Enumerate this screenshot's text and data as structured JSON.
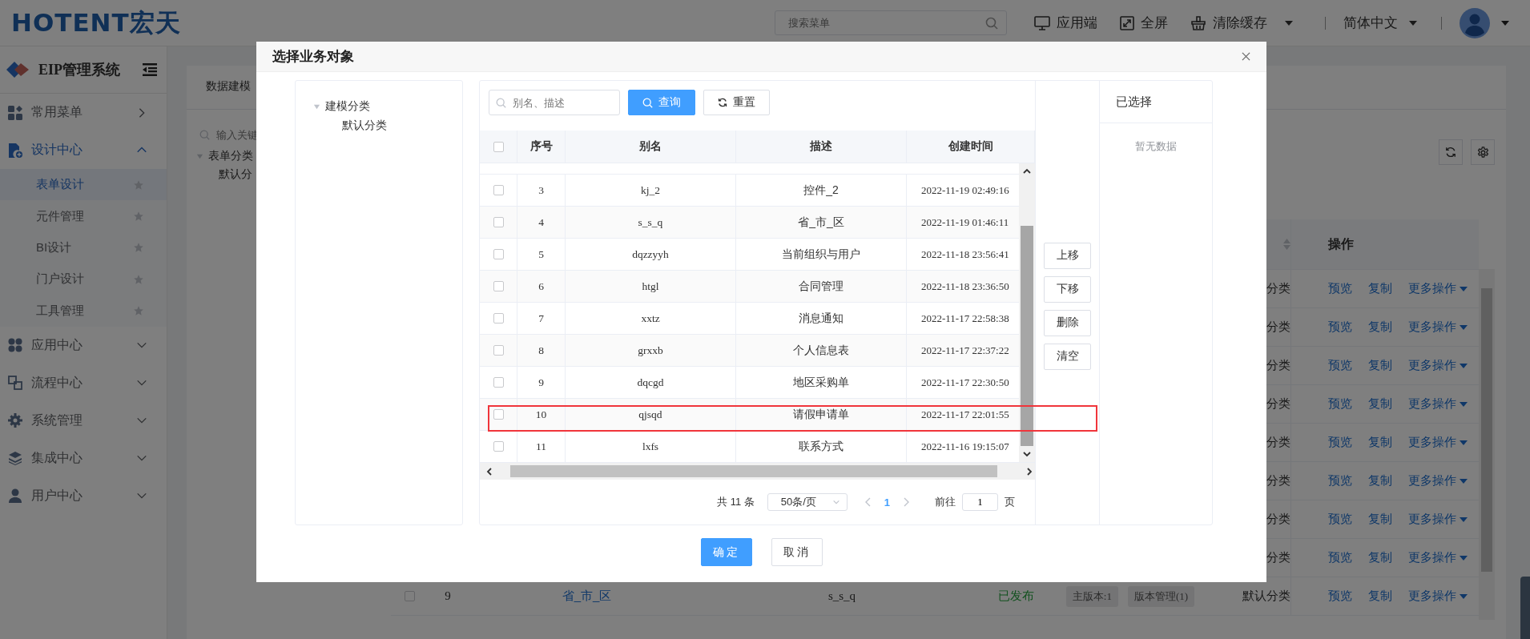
{
  "header": {
    "logo": "HOTENT宏天",
    "search": {
      "placeholder": "搜索菜单"
    },
    "tools": [
      {
        "label": "应用端",
        "dropdown": false
      },
      {
        "label": "全屏",
        "dropdown": false
      },
      {
        "label": "清除缓存",
        "dropdown": true
      }
    ],
    "language": "简体中文"
  },
  "sidebar": {
    "title": "EIP管理系统",
    "items": [
      {
        "kind": "flyout",
        "label": "常用菜单",
        "expanded": false
      },
      {
        "kind": "group",
        "label": "设计中心",
        "expanded": true,
        "children": [
          {
            "label": "表单设计",
            "selected": true
          },
          {
            "label": "元件管理",
            "selected": false
          },
          {
            "label": "BI设计",
            "selected": false
          },
          {
            "label": "门户设计",
            "selected": false
          },
          {
            "label": "工具管理",
            "selected": false
          }
        ]
      },
      {
        "kind": "group",
        "label": "应用中心",
        "expanded": false
      },
      {
        "kind": "group",
        "label": "流程中心",
        "expanded": false
      },
      {
        "kind": "group",
        "label": "系统管理",
        "expanded": false
      },
      {
        "kind": "group",
        "label": "集成中心",
        "expanded": false
      },
      {
        "kind": "group",
        "label": "用户中心",
        "expanded": false
      }
    ]
  },
  "background": {
    "tab": "数据建模",
    "tree_search": {
      "placeholder": "输入关键"
    },
    "tree": {
      "label": "表单分类",
      "expanded": true,
      "children": [
        {
          "label": "默认分"
        }
      ]
    },
    "table": {
      "actions_header": "操作",
      "rows": [
        {
          "category": "分类",
          "actions": [
            "预览",
            "复制",
            "更多操作"
          ]
        },
        {
          "category": "分类",
          "actions": [
            "预览",
            "复制",
            "更多操作"
          ]
        },
        {
          "category": "分类",
          "actions": [
            "预览",
            "复制",
            "更多操作"
          ]
        },
        {
          "category": "分类",
          "actions": [
            "预览",
            "复制",
            "更多操作"
          ]
        },
        {
          "category": "分类",
          "actions": [
            "预览",
            "复制",
            "更多操作"
          ]
        },
        {
          "category": "分类",
          "actions": [
            "预览",
            "复制",
            "更多操作"
          ]
        },
        {
          "category": "分类",
          "actions": [
            "预览",
            "复制",
            "更多操作"
          ]
        },
        {
          "category": "分类",
          "actions": [
            "预览",
            "复制",
            "更多操作"
          ]
        },
        {
          "checked": false,
          "number": "9",
          "alias": "省_市_区",
          "name": "s_s_q",
          "status": "已发布",
          "version": "主版本:1",
          "version_manage": "版本管理(1)",
          "category": "默认分类",
          "actions": [
            "预览",
            "复制",
            "更多操作"
          ]
        }
      ]
    }
  },
  "dialog": {
    "title": "选择业务对象",
    "tree": {
      "label": "建模分类",
      "expanded": true,
      "children": [
        {
          "label": "默认分类"
        }
      ]
    },
    "search": {
      "placeholder": "别名、描述"
    },
    "buttons": [
      {
        "label": "查询",
        "kind": "primary"
      },
      {
        "label": "重置",
        "kind": "default"
      }
    ],
    "table": {
      "select_all": {
        "checked": false
      },
      "columns": [
        "序号",
        "别名",
        "描述",
        "创建时间"
      ],
      "rows": [
        {
          "checked": false,
          "highlighted": false,
          "number": "3",
          "alias": "kj_2",
          "description": "控件_2",
          "created": "2022-11-19 02:49:16"
        },
        {
          "checked": false,
          "highlighted": false,
          "number": "4",
          "alias": "s_s_q",
          "description": "省_市_区",
          "created": "2022-11-19 01:46:11"
        },
        {
          "checked": false,
          "highlighted": false,
          "number": "5",
          "alias": "dqzzyyh",
          "description": "当前组织与用户",
          "created": "2022-11-18 23:56:41"
        },
        {
          "checked": false,
          "highlighted": false,
          "number": "6",
          "alias": "htgl",
          "description": "合同管理",
          "created": "2022-11-18 23:36:50"
        },
        {
          "checked": false,
          "highlighted": false,
          "number": "7",
          "alias": "xxtz",
          "description": "消息通知",
          "created": "2022-11-17 22:58:38"
        },
        {
          "checked": false,
          "highlighted": false,
          "number": "8",
          "alias": "grxxb",
          "description": "个人信息表",
          "created": "2022-11-17 22:37:22"
        },
        {
          "checked": false,
          "highlighted": false,
          "number": "9",
          "alias": "dqcgd",
          "description": "地区采购单",
          "created": "2022-11-17 22:30:50"
        },
        {
          "checked": false,
          "highlighted": true,
          "number": "10",
          "alias": "qjsqd",
          "description": "请假申请单",
          "created": "2022-11-17 22:01:55"
        },
        {
          "checked": false,
          "highlighted": false,
          "number": "11",
          "alias": "lxfs",
          "description": "联系方式",
          "created": "2022-11-16 19:15:07"
        }
      ]
    },
    "pagination": {
      "total": "共 11 条",
      "page_size": "50条/页",
      "pages": [
        {
          "label": "1",
          "selected": true
        }
      ],
      "goto_label": "前往",
      "goto_value": "1",
      "goto_suffix": "页"
    },
    "move_buttons": [
      "上移",
      "下移",
      "删除",
      "清空"
    ],
    "selected_panel": {
      "title": "已选择",
      "empty_text": "暂无数据"
    },
    "footer_buttons": [
      {
        "label": "确定",
        "kind": "primary"
      },
      {
        "label": "取消",
        "kind": "default"
      }
    ]
  }
}
